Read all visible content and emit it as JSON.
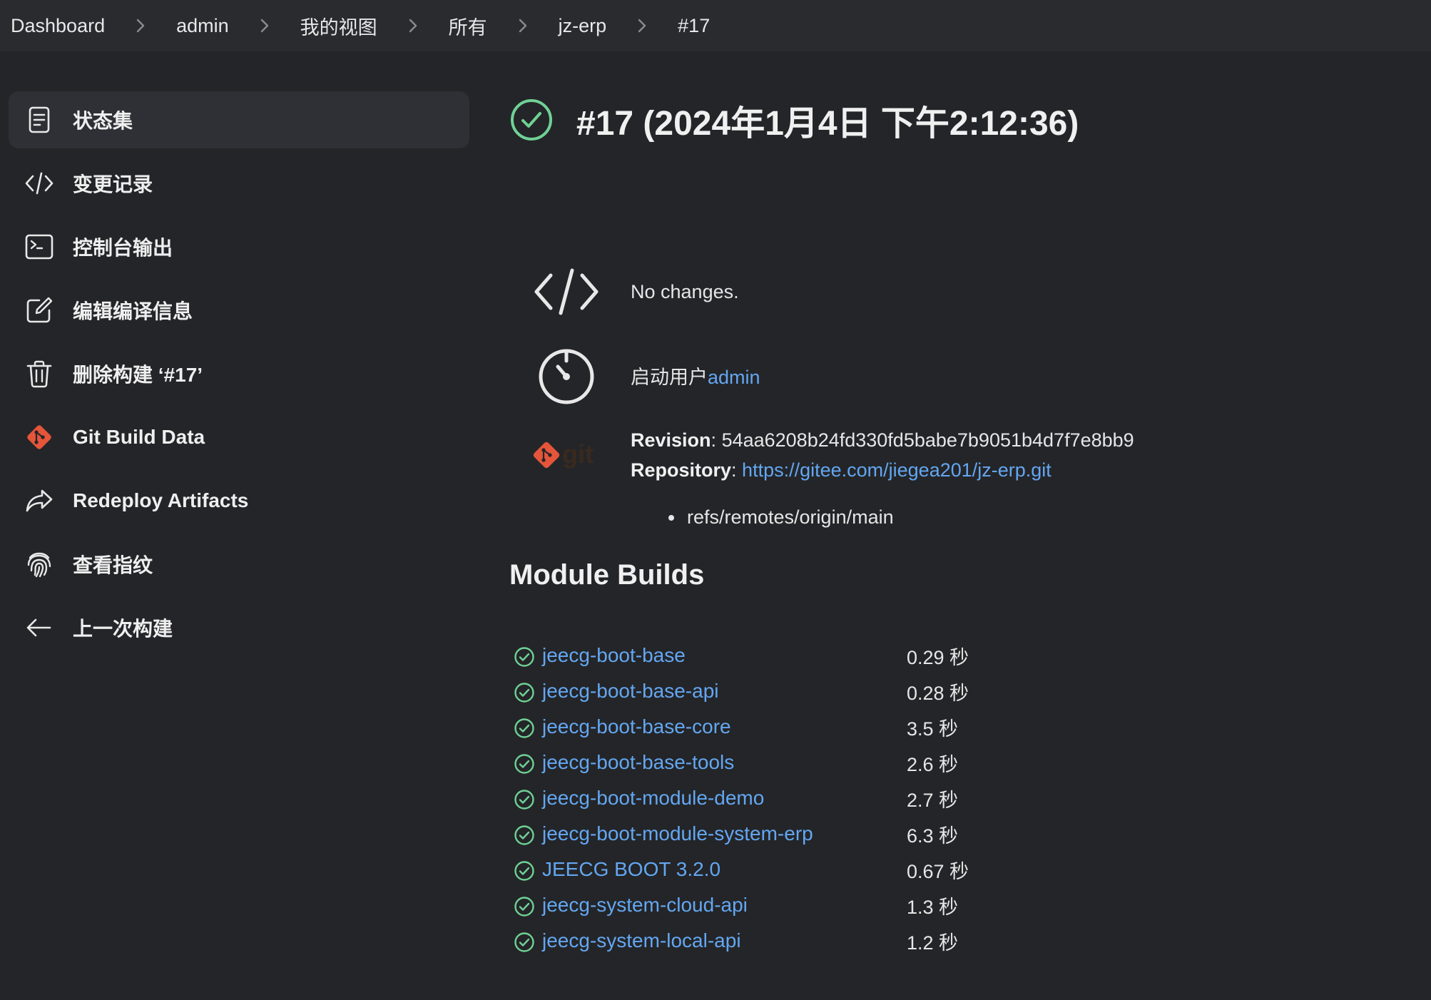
{
  "breadcrumb": [
    {
      "label": "Dashboard"
    },
    {
      "label": "admin"
    },
    {
      "label": "我的视图"
    },
    {
      "label": "所有"
    },
    {
      "label": "jz-erp"
    },
    {
      "label": "#17"
    }
  ],
  "sidebar": {
    "items": [
      {
        "label": "状态集",
        "icon": "document-icon",
        "active": true
      },
      {
        "label": "变更记录",
        "icon": "code-icon"
      },
      {
        "label": "控制台输出",
        "icon": "terminal-icon"
      },
      {
        "label": "编辑编译信息",
        "icon": "edit-icon"
      },
      {
        "label": "删除构建 ‘#17’",
        "icon": "trash-icon"
      },
      {
        "label": "Git Build Data",
        "icon": "git-icon"
      },
      {
        "label": "Redeploy Artifacts",
        "icon": "redeploy-icon"
      },
      {
        "label": "查看指纹",
        "icon": "fingerprint-icon"
      },
      {
        "label": "上一次构建",
        "icon": "arrow-left-icon"
      }
    ]
  },
  "build": {
    "title": "#17 (2024年1月4日 下午2:12:36)",
    "status": "success",
    "changes_text": "No changes.",
    "started_by_prefix": "启动用户",
    "started_by_user": "admin",
    "revision_label": "Revision",
    "revision_value": "54aa6208b24fd330fd5babe7b9051b4d7f7e8bb9",
    "repository_label": "Repository",
    "repository_url": "https://gitee.com/jiegea201/jz-erp.git",
    "ref": "refs/remotes/origin/main"
  },
  "module_builds": {
    "heading": "Module Builds",
    "items": [
      {
        "name": "jeecg-boot-base",
        "time": "0.29 秒"
      },
      {
        "name": "jeecg-boot-base-api",
        "time": "0.28 秒"
      },
      {
        "name": "jeecg-boot-base-core",
        "time": "3.5 秒"
      },
      {
        "name": "jeecg-boot-base-tools",
        "time": "2.6 秒"
      },
      {
        "name": "jeecg-boot-module-demo",
        "time": "2.7 秒"
      },
      {
        "name": "jeecg-boot-module-system-erp",
        "time": "6.3 秒"
      },
      {
        "name": "JEECG BOOT 3.2.0",
        "time": "0.67 秒"
      },
      {
        "name": "jeecg-system-cloud-api",
        "time": "1.3 秒"
      },
      {
        "name": "jeecg-system-local-api",
        "time": "1.2 秒"
      }
    ]
  },
  "colors": {
    "background": "#242528",
    "topbar": "#2a2b2f",
    "link": "#63a7f2",
    "success": "#6fd195",
    "git": "#e4553a"
  }
}
